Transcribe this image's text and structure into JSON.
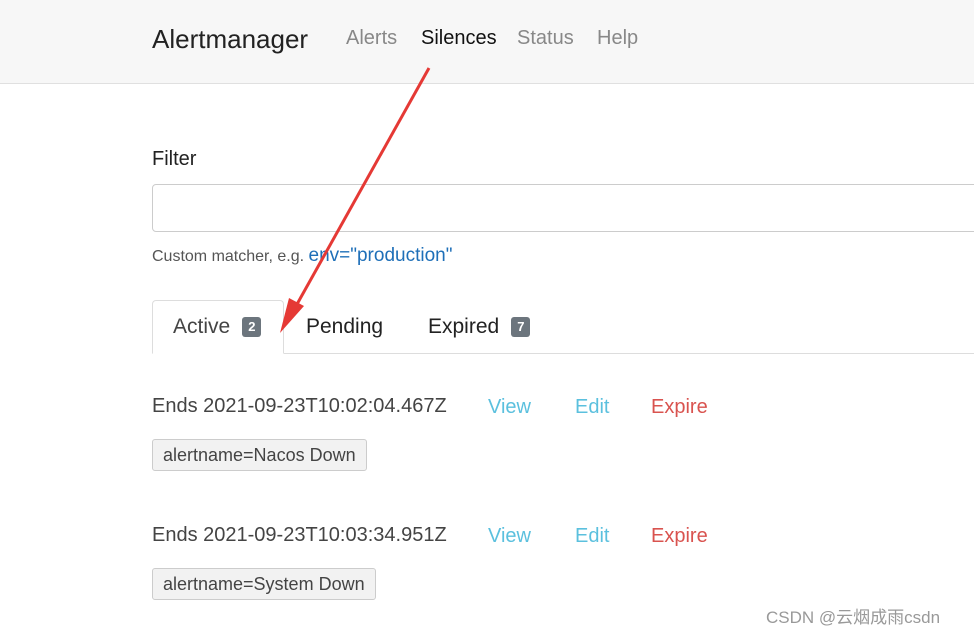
{
  "navbar": {
    "brand": "Alertmanager",
    "links": [
      {
        "label": "Alerts",
        "active": false
      },
      {
        "label": "Silences",
        "active": true
      },
      {
        "label": "Status",
        "active": false
      },
      {
        "label": "Help",
        "active": false
      }
    ]
  },
  "filter": {
    "label": "Filter",
    "value": "",
    "hint_prefix": "Custom matcher, e.g. ",
    "hint_code": "env=\"production\""
  },
  "tabs": [
    {
      "label": "Active",
      "badge": "2",
      "active": true
    },
    {
      "label": "Pending",
      "badge": "",
      "active": false
    },
    {
      "label": "Expired",
      "badge": "7",
      "active": false
    }
  ],
  "silences": [
    {
      "ends": "Ends 2021-09-23T10:02:04.467Z",
      "view": "View",
      "edit": "Edit",
      "expire": "Expire",
      "matcher": "alertname=Nacos Down"
    },
    {
      "ends": "Ends 2021-09-23T10:03:34.951Z",
      "view": "View",
      "edit": "Edit",
      "expire": "Expire",
      "matcher": "alertname=System Down"
    }
  ],
  "watermark": "CSDN @云烟成雨csdn",
  "colors": {
    "arrow": "#e53935",
    "info": "#5bc0de",
    "danger": "#d9534f",
    "badge": "#6c757d"
  }
}
